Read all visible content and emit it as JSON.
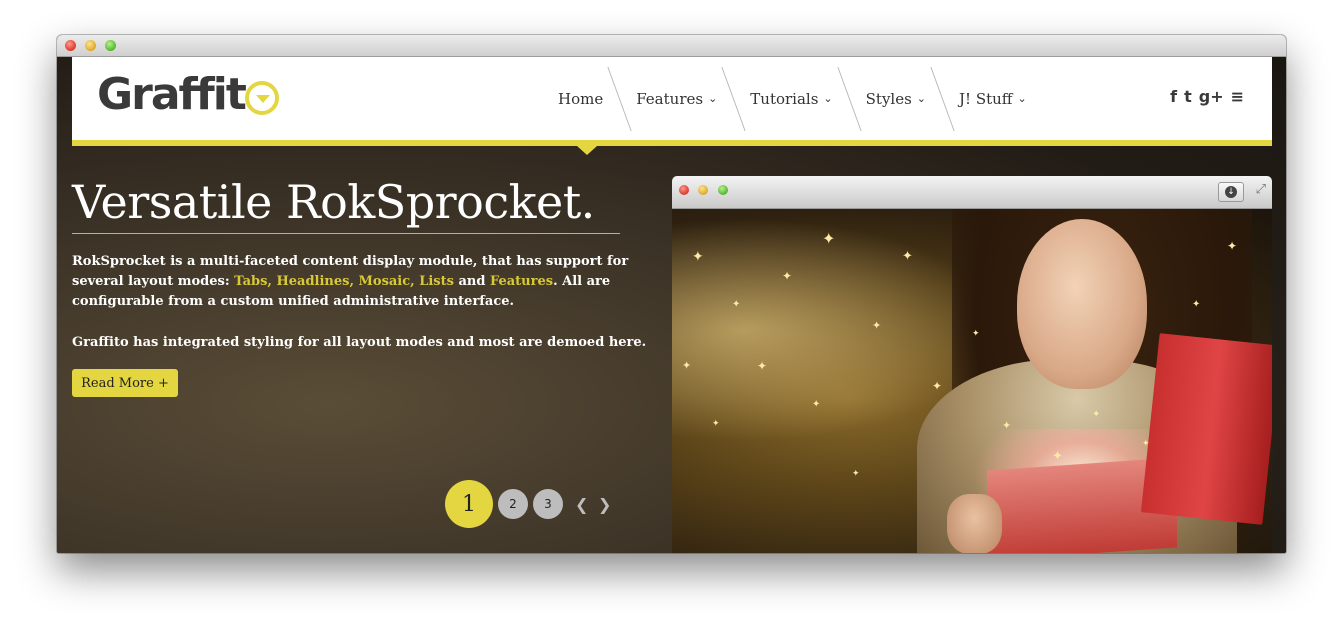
{
  "site": {
    "logo_text": "Graffit",
    "nav": [
      {
        "label": "Home",
        "has_dropdown": false
      },
      {
        "label": "Features",
        "has_dropdown": true
      },
      {
        "label": "Tutorials",
        "has_dropdown": true
      },
      {
        "label": "Styles",
        "has_dropdown": true
      },
      {
        "label": "J! Stuff",
        "has_dropdown": true
      }
    ],
    "social": [
      {
        "name": "facebook-icon",
        "glyph": "f"
      },
      {
        "name": "twitter-icon",
        "glyph": "t"
      },
      {
        "name": "google-plus-icon",
        "glyph": "g+"
      },
      {
        "name": "rss-icon",
        "glyph": "≡"
      }
    ],
    "accent_color": "#e3d640"
  },
  "hero": {
    "title": "Versatile RokSprocket.",
    "text_start": "RokSprocket is a multi-faceted content display module, that has support for several layout modes: ",
    "text_links": "Tabs, Headlines, Mosaic, Lists",
    "text_and": " and ",
    "text_link_features": "Features",
    "text_end": ".  All are configurable from a custom unified administrative interface.",
    "text2": "Graffito has integrated styling for all layout modes and most are demoed here.",
    "read_more": "Read More +"
  },
  "pagination": {
    "pages": [
      "1",
      "2",
      "3"
    ],
    "active": "1",
    "prev": "❮",
    "next": "❯"
  },
  "image_window": {
    "download_icon": "download-icon",
    "expand_icon": "expand-icon"
  }
}
